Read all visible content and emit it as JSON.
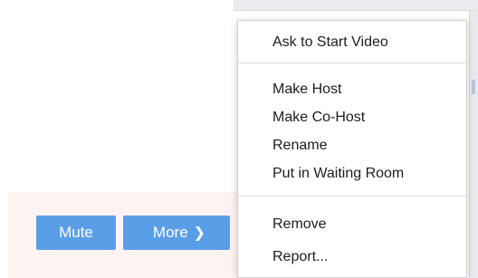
{
  "participant_actions": {
    "mute_label": "Mute",
    "more_label": "More",
    "more_chevron": "❯"
  },
  "context_menu": {
    "groups": [
      [
        "Ask to Start Video"
      ],
      [
        "Make Host",
        "Make Co-Host",
        "Rename",
        "Put in Waiting Room"
      ],
      [
        "Remove",
        "Report..."
      ]
    ]
  },
  "colors": {
    "button_blue": "#5b9ee8",
    "row_highlight": "#fdf3f1",
    "menu_text": "#1c1c1c"
  }
}
